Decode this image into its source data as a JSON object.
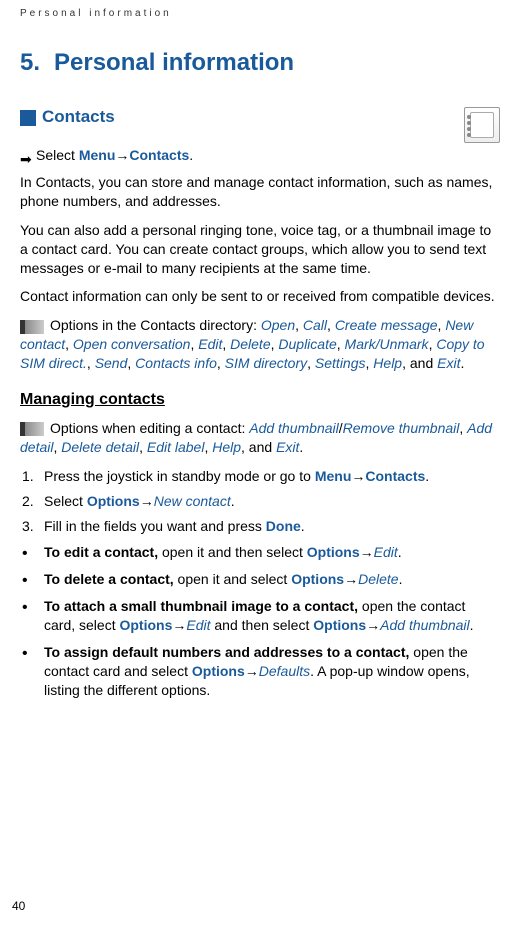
{
  "header": {
    "running_title": "Personal information"
  },
  "chapter": {
    "number": "5.",
    "title": "Personal information"
  },
  "section": {
    "title": "Contacts"
  },
  "nav": {
    "prefix": "Select ",
    "menu": "Menu",
    "arrow": "→",
    "target": "Contacts",
    "suffix": "."
  },
  "paragraphs": {
    "intro": "In Contacts, you can store and manage contact information, such as names, phone numbers, and addresses.",
    "ringtone": "You can also add a personal ringing tone, voice tag, or a thumbnail image to a contact card. You can create contact groups, which allow you to send text messages or e-mail to many recipients at the same time.",
    "compat": "Contact information can only be sent to or received from compatible devices."
  },
  "options_dir": {
    "prefix": "Options in the Contacts directory: ",
    "items": [
      "Open",
      "Call",
      "Create message",
      "New contact",
      "Open conversation",
      "Edit",
      "Delete",
      "Duplicate",
      "Mark/Unmark",
      "Copy to SIM direct.",
      "Send",
      "Contacts info",
      "SIM directory",
      "Settings",
      "Help"
    ],
    "and": ", and ",
    "last": "Exit",
    "end": "."
  },
  "subsection": {
    "title": "Managing contacts"
  },
  "options_edit": {
    "prefix": "Options when editing a contact: ",
    "pair_a": "Add thumbnail",
    "pair_sep": "/",
    "pair_b": "Remove thumbnail",
    "items": [
      "Add detail",
      "Delete detail",
      "Edit label",
      "Help"
    ],
    "and": ", and ",
    "last": "Exit",
    "end": "."
  },
  "steps": {
    "s1_a": "Press the joystick in standby mode or go to ",
    "s1_menu": "Menu",
    "s1_arrow": "→",
    "s1_target": "Contacts",
    "s1_end": ".",
    "s2_a": "Select ",
    "s2_opt": "Options",
    "s2_arrow": "→",
    "s2_target": "New contact",
    "s2_end": ".",
    "s3_a": "Fill in the fields you want and press ",
    "s3_done": "Done",
    "s3_end": "."
  },
  "bullets": {
    "b1_bold": "To edit a contact,",
    "b1_a": " open it and then select ",
    "b1_opt": "Options",
    "b1_arrow": "→",
    "b1_target": "Edit",
    "b1_end": ".",
    "b2_bold": "To delete a contact,",
    "b2_a": " open it and select ",
    "b2_opt": "Options",
    "b2_arrow": "→",
    "b2_target": "Delete",
    "b2_end": ".",
    "b3_bold": "To attach a small thumbnail image to a contact,",
    "b3_a": " open the contact card, select ",
    "b3_opt1": "Options",
    "b3_arrow1": "→",
    "b3_t1": "Edit",
    "b3_mid": " and then select ",
    "b3_opt2": "Options",
    "b3_arrow2": "→",
    "b3_t2": "Add thumbnail",
    "b3_end": ".",
    "b4_bold": "To assign default numbers and addresses to a contact,",
    "b4_a": " open the contact card and select ",
    "b4_opt": "Options",
    "b4_arrow": "→",
    "b4_target": "Defaults",
    "b4_end": ". A pop-up window opens, listing the different options."
  },
  "page_number": "40"
}
